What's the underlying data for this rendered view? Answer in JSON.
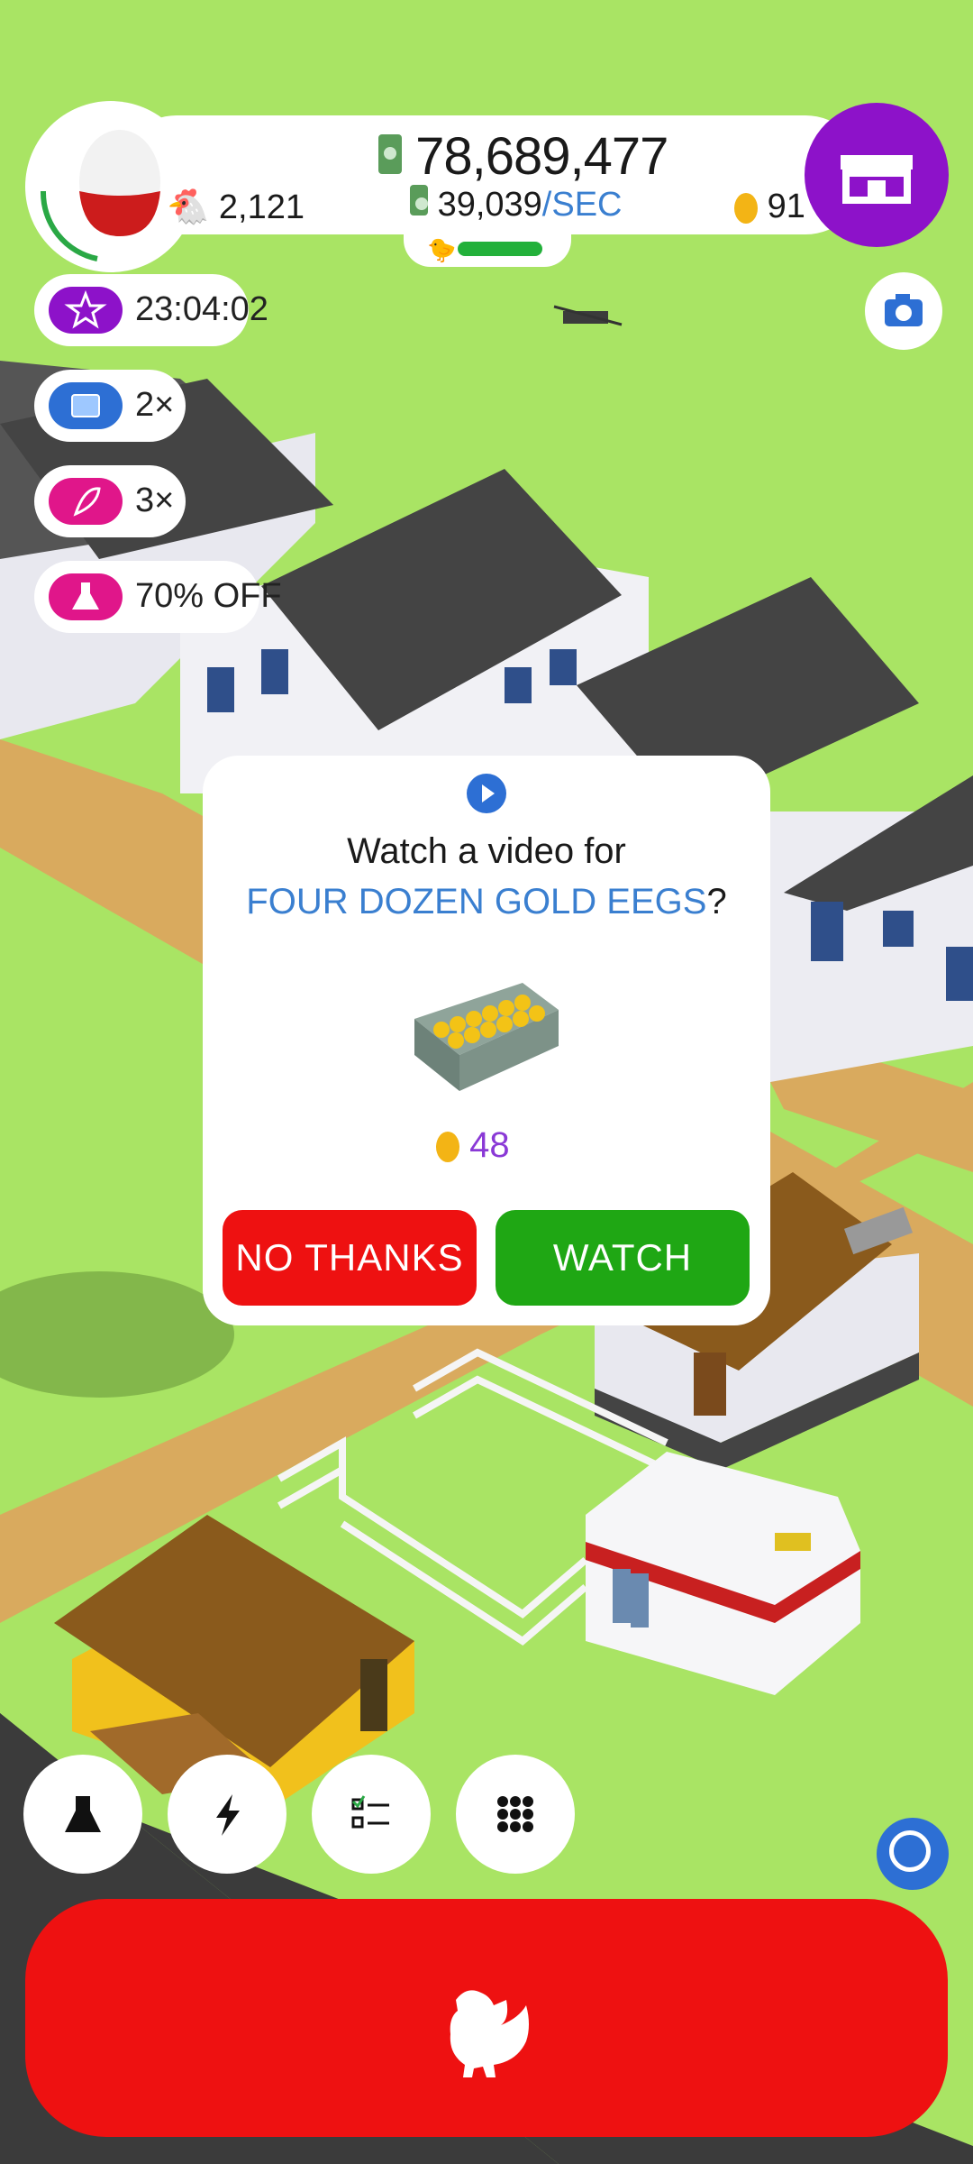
{
  "hud": {
    "money": "78,689,477",
    "rate_value": "39,039",
    "rate_unit": "/SEC",
    "chickens": "2,121",
    "golden_eggs": "91",
    "shop_icon": "shop-icon",
    "camera_icon": "camera-icon"
  },
  "boosts": [
    {
      "label": "23:04:02",
      "icon": "star-icon",
      "color": "#8d12c9"
    },
    {
      "label": "2×",
      "icon": "tv-icon",
      "color": "#2d6fd4"
    },
    {
      "label": "3×",
      "icon": "feather-icon",
      "color": "#e0168a"
    },
    {
      "label": "70% OFF",
      "icon": "flask-icon",
      "color": "#e0168a"
    }
  ],
  "dialog": {
    "line1": "Watch a video for",
    "line2_highlight": "FOUR DOZEN GOLD EEGS",
    "line2_suffix": "?",
    "cost": "48",
    "no_label": "NO THANKS",
    "watch_label": "WATCH"
  },
  "toolbar": [
    {
      "icon": "flask-icon"
    },
    {
      "icon": "lightning-icon"
    },
    {
      "icon": "checklist-icon"
    },
    {
      "icon": "grid-icon"
    }
  ],
  "colors": {
    "grass": "#a9e464",
    "accent_purple": "#8d12c9",
    "red": "#ee1111",
    "green": "#1fa714",
    "blue_text": "#3a7fd0"
  }
}
